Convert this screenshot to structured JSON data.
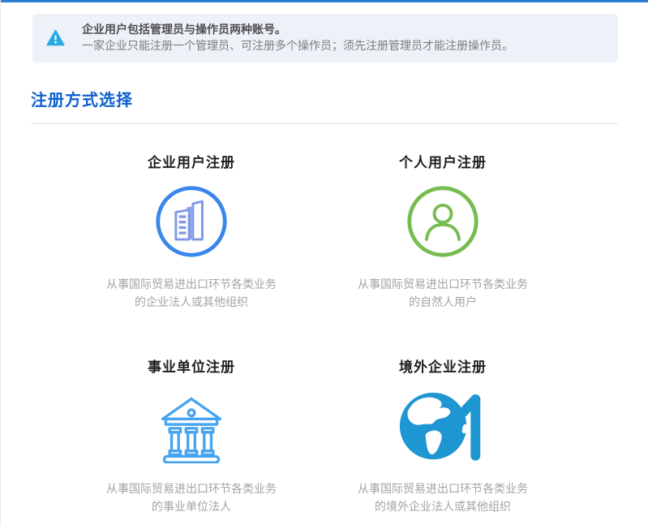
{
  "page": {
    "top_bar_color": "#2c7bd4",
    "section_title": "注册方式选择"
  },
  "alert": {
    "icon": "warning-triangle-icon",
    "icon_color": "#29aae3",
    "background_color": "#edf1f8",
    "title": "企业用户包括管理员与操作员两种账号。",
    "body": "一家企业只能注册一个管理员、可注册多个操作员；须先注册管理员才能注册操作员。"
  },
  "cards": [
    {
      "title": "企业用户注册",
      "icon": "enterprise-building-icon",
      "icon_color": "#3a86ea",
      "desc_line1": "从事国际贸易进出口环节各类业务",
      "desc_line2": "的企业法人或其他组织"
    },
    {
      "title": "个人用户注册",
      "icon": "person-icon",
      "icon_color": "#76bc4f",
      "desc_line1": "从事国际贸易进出口环节各类业务",
      "desc_line2": "的自然人用户"
    },
    {
      "title": "事业单位注册",
      "icon": "bank-icon",
      "icon_color": "#47a4f0",
      "desc_line1": "从事国际贸易进出口环节各类业务",
      "desc_line2": "的事业单位法人"
    },
    {
      "title": "境外企业注册",
      "icon": "globe-arrow-icon",
      "icon_color": "#1e96d2",
      "desc_line1": "从事国际贸易进出口环节各类业务",
      "desc_line2": "的境外企业法人或其他组织"
    }
  ]
}
